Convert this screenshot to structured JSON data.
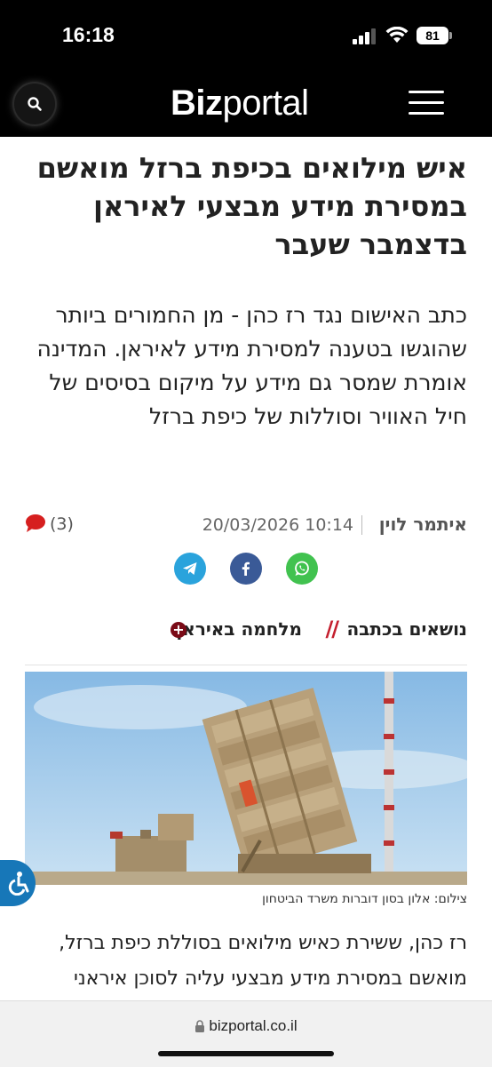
{
  "status": {
    "time": "16:18",
    "battery": "81"
  },
  "header": {
    "logo_bold": "Biz",
    "logo_light": "portal"
  },
  "article": {
    "headline": "איש מילואים בכיפת ברזל מואשם במסירת מידע מבצעי לאיראן בדצמבר שעבר",
    "subtitle": "כתב האישום נגד רז כהן - מן החמורים ביותר שהוגשו בטענה למסירת מידע לאיראן. המדינה אומרת שמסר גם מידע על מיקום בסיסים של חיל האוויר וסוללות של כיפת ברזל",
    "author": "איתמר לוין",
    "datetime": "20/03/2026 10:14",
    "comments_count": "(3)",
    "share": [
      "telegram",
      "facebook",
      "whatsapp"
    ],
    "topics_label": "נושאים בכתבה",
    "topic_tag": "מלחמה באיראן",
    "photo_caption": "צילום: אלון בסון דוברות משרד הביטחון",
    "body_text": "רז כהן, ששירת כאיש מילואים בסוללת כיפת ברזל, מואשם במסירת מידע מבצעי עליה לסוכן איראני"
  },
  "browser": {
    "url": "bizportal.co.il"
  },
  "colors": {
    "accent": "#c41f2e",
    "telegram": "#2aa3dc",
    "facebook": "#3a5a97",
    "whatsapp": "#41c24f",
    "access": "#1777b8"
  }
}
